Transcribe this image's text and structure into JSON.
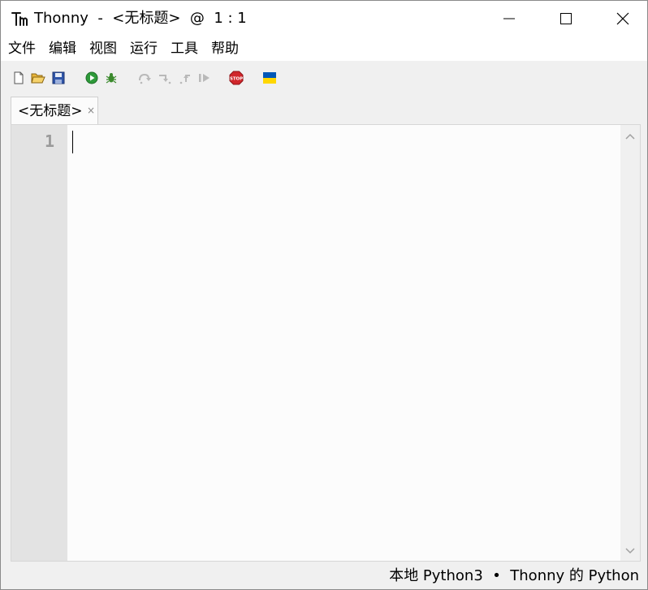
{
  "window": {
    "title": "Thonny  -  <无标题>  @  1 : 1"
  },
  "menu": {
    "items": [
      "文件",
      "编辑",
      "视图",
      "运行",
      "工具",
      "帮助"
    ]
  },
  "toolbar": {
    "buttons": [
      {
        "name": "new-file-icon"
      },
      {
        "name": "open-file-icon"
      },
      {
        "name": "save-file-icon"
      },
      {
        "name": "run-icon"
      },
      {
        "name": "debug-icon"
      },
      {
        "name": "step-over-icon"
      },
      {
        "name": "step-into-icon"
      },
      {
        "name": "step-out-icon"
      },
      {
        "name": "resume-icon"
      },
      {
        "name": "stop-icon",
        "label": "STOP"
      },
      {
        "name": "ukraine-flag-icon"
      }
    ]
  },
  "tabs": [
    {
      "label": "<无标题>",
      "close": "×"
    }
  ],
  "editor": {
    "line_numbers": [
      "1"
    ]
  },
  "statusbar": {
    "text": "本地 Python3  •  Thonny 的 Python"
  },
  "colors": {
    "run_green": "#2e9a3a",
    "stop_red": "#d0262b",
    "flag_blue": "#0057b7",
    "flag_yellow": "#ffd700",
    "gutter": "#e3e3e3"
  }
}
